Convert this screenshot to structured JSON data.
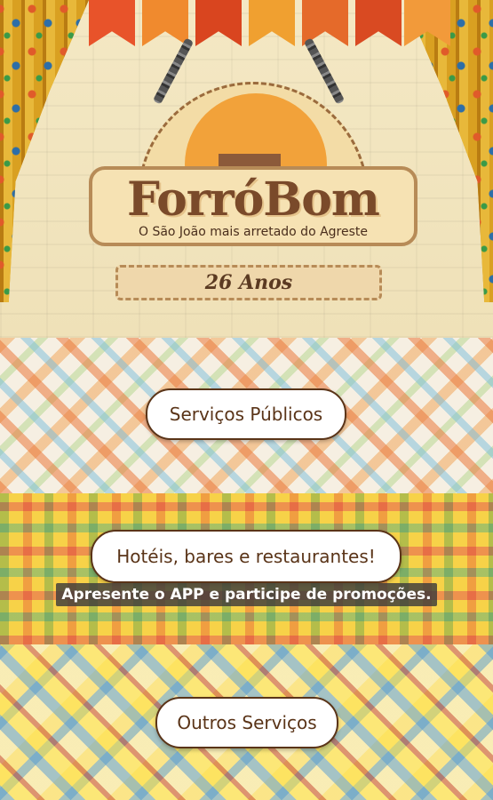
{
  "header": {
    "brand_title": "ForróBom",
    "tagline": "O São João mais arretado do Agreste",
    "anniversary": "26 Anos"
  },
  "sections": {
    "public_services": {
      "button_label": "Serviços Públicos"
    },
    "hotels": {
      "button_label": "Hotéis, bares e restaurantes!",
      "promo_text": "Apresente o APP e participe de promoções."
    },
    "other_services": {
      "button_label": "Outros Serviços"
    }
  },
  "colors": {
    "button_text": "#5a3418",
    "brand_brown": "#7a4a2a",
    "flag_colors": [
      "#e8532a",
      "#f08a2e",
      "#d9451f",
      "#f0a030",
      "#e56a2a",
      "#d94a22",
      "#f29a3a"
    ]
  }
}
